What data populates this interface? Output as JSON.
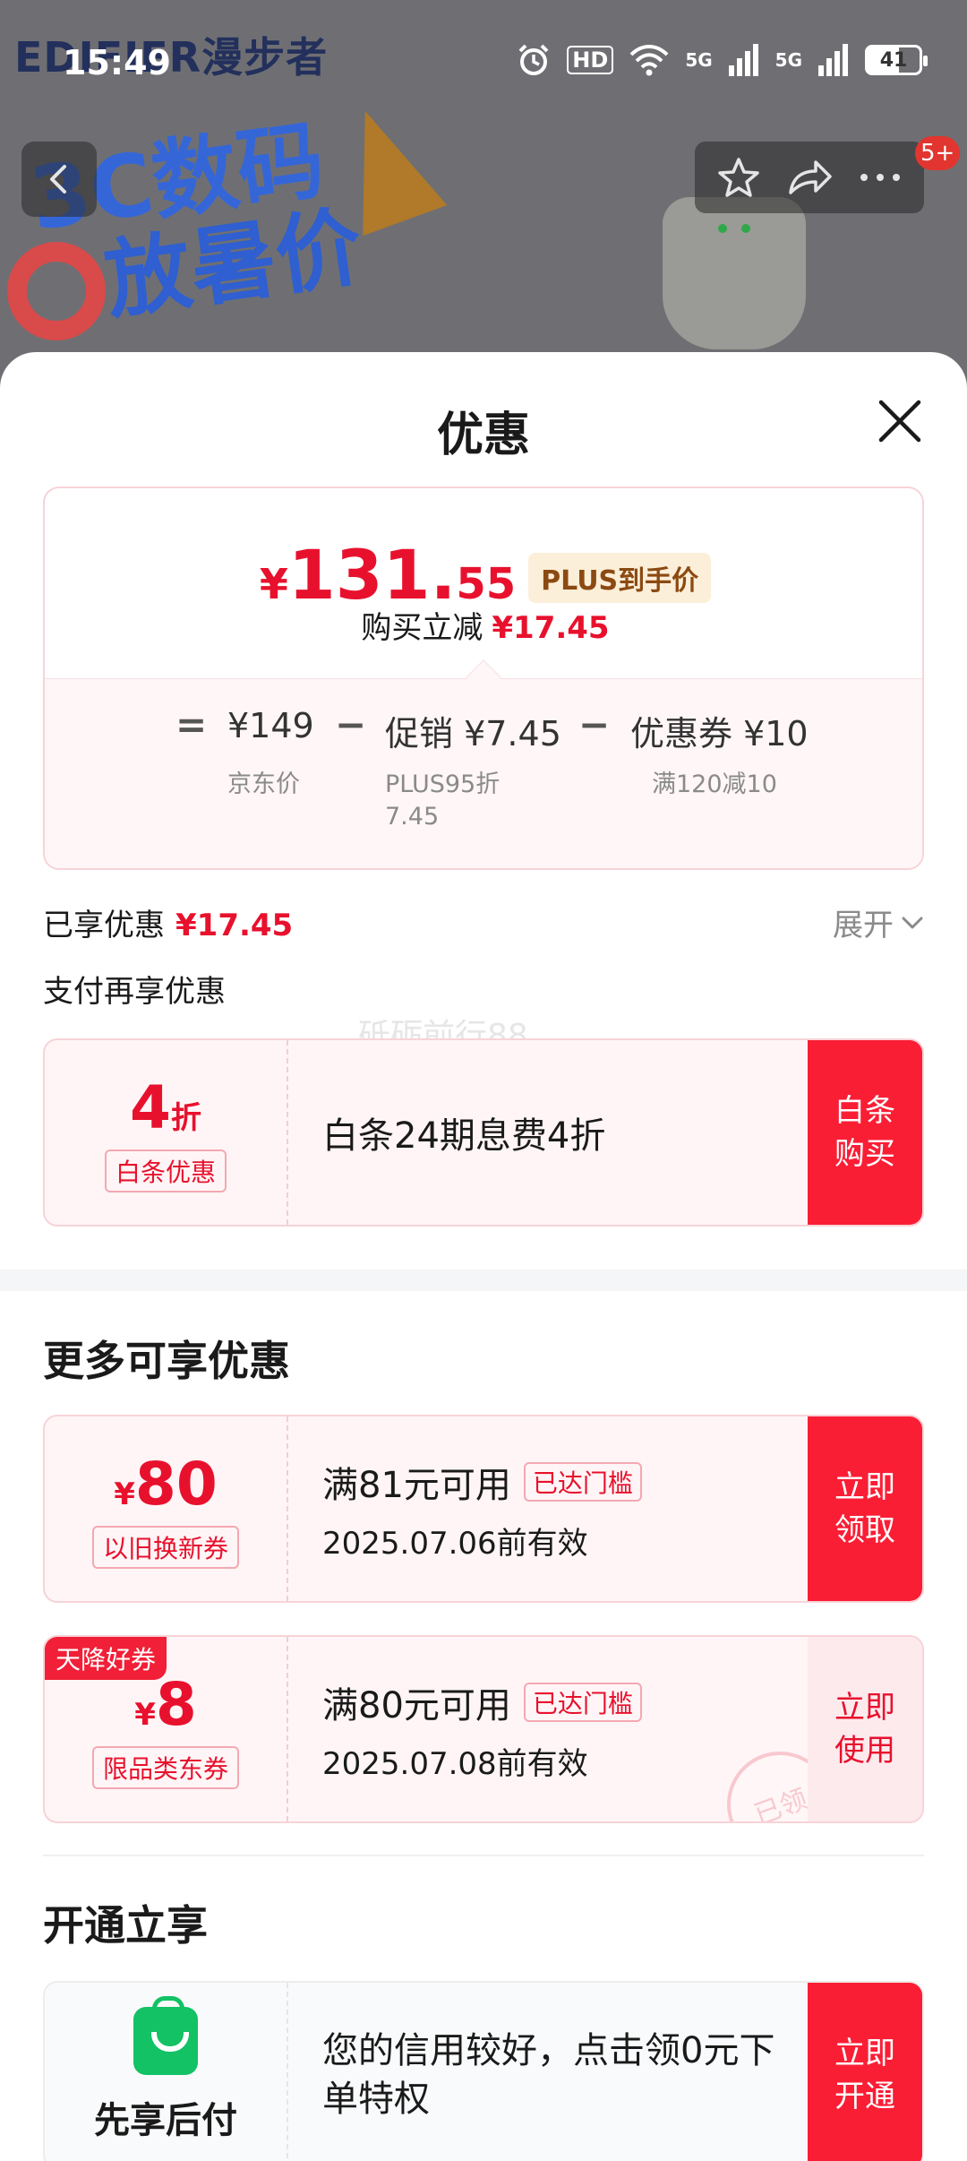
{
  "status_bar": {
    "time": "15:49",
    "hd": "HD",
    "signal1": "5G",
    "signal2": "5G",
    "battery": "41"
  },
  "background": {
    "brand": "EDIFIER漫步者",
    "banner_line1": "3C数码",
    "banner_line2": "放暑价",
    "badge": "5+"
  },
  "sheet": {
    "title": "优惠",
    "price": {
      "currency": "¥",
      "integer": "131.",
      "decimal": "55",
      "tag": "PLUS到手价",
      "save_label": "购买立减",
      "save_value": "¥17.45"
    },
    "calc": {
      "eq": "=",
      "item1": "¥149",
      "item1_sub": "京东价",
      "op1": "−",
      "item2": "促销 ¥7.45",
      "item2_sub_line1": "PLUS95折",
      "item2_sub_line2": "7.45",
      "op2": "−",
      "item3": "优惠券 ¥10",
      "item3_sub": "满120减10"
    },
    "enjoyed_label": "已享优惠",
    "enjoyed_value": "¥17.45",
    "expand_label": "展开",
    "pay_again_label": "支付再享优惠",
    "watermark": "砥砺前行88",
    "baitiao": {
      "amount": "4",
      "unit": "折",
      "label": "白条优惠",
      "text": "白条24期息费4折",
      "button": "白条购买"
    },
    "more_title": "更多可享优惠",
    "coupons": [
      {
        "currency": "¥",
        "amount": "80",
        "label": "以旧换新券",
        "title": "满81元可用",
        "tag": "已达门槛",
        "date": "2025.07.06前有效",
        "button": "立即领取"
      },
      {
        "ribbon": "天降好券",
        "currency": "¥",
        "amount": "8",
        "label": "限品类东券",
        "title": "满80元可用",
        "tag": "已达门槛",
        "date": "2025.07.08前有效",
        "button": "立即使用",
        "stamp": "已领"
      }
    ],
    "open_title": "开通立享",
    "pay_later": {
      "name": "先享后付",
      "text": "您的信用较好，点击领0元下单特权",
      "button": "立即开通"
    }
  },
  "colors": {
    "accent_red": "#e8112d",
    "button_red": "#fa1e35",
    "plus_bg": "#fcefd9",
    "pay_green": "#12c265"
  }
}
